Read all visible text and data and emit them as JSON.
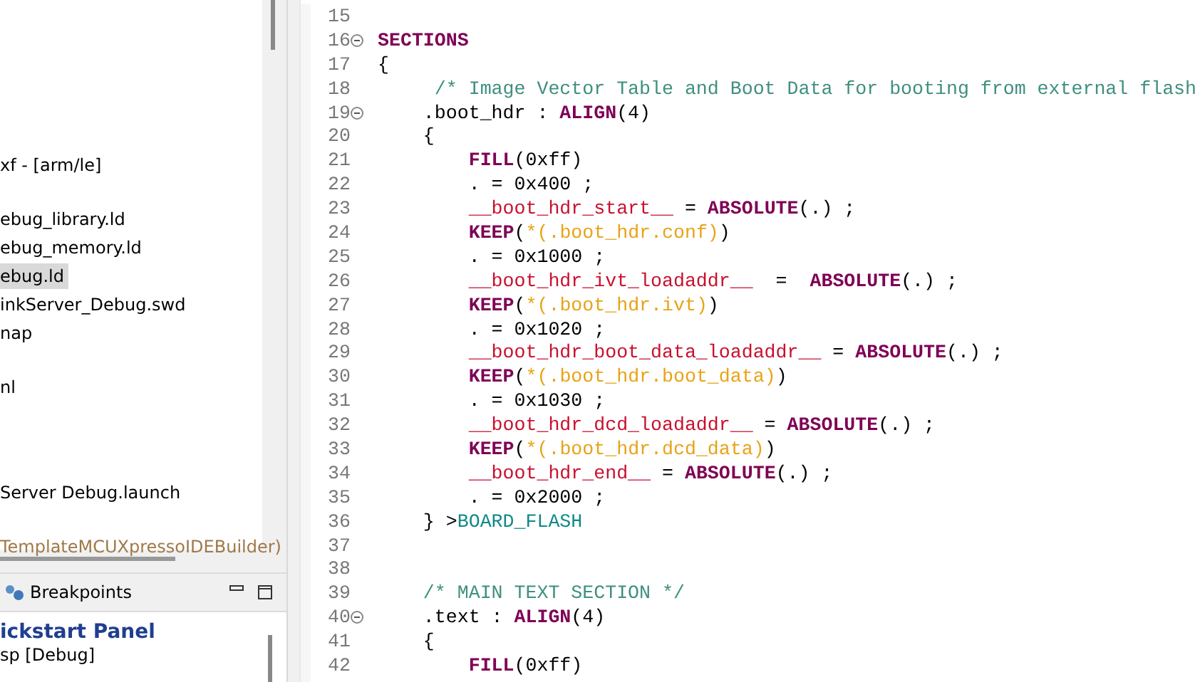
{
  "project_explorer": {
    "items": [
      {
        "label": "xf - [arm/le]",
        "selected": false,
        "kind": "plain"
      },
      {
        "label": "ebug_library.ld",
        "selected": false,
        "kind": "plain"
      },
      {
        "label": "ebug_memory.ld",
        "selected": false,
        "kind": "plain"
      },
      {
        "label": "ebug.ld",
        "selected": true,
        "kind": "plain"
      },
      {
        "label": "inkServer_Debug.swd",
        "selected": false,
        "kind": "plain"
      },
      {
        "label": "nap",
        "selected": false,
        "kind": "plain"
      },
      {
        "label": "nl",
        "selected": false,
        "kind": "plain"
      },
      {
        "label": "Server Debug.launch",
        "selected": false,
        "kind": "plain"
      },
      {
        "label": "TemplateMCUXpressoIDEBuilder)",
        "selected": false,
        "kind": "decoration"
      }
    ]
  },
  "bottom_view": {
    "tab": {
      "label": "Breakpoints"
    },
    "heading": "ickstart Panel",
    "subtitle": "sp [Debug]"
  },
  "editor": {
    "lines": [
      {
        "number": "15",
        "foldable": false
      },
      {
        "number": "16",
        "foldable": true,
        "tokens": [
          {
            "kind": "keyword",
            "text": "SECTIONS"
          }
        ]
      },
      {
        "number": "17",
        "foldable": false,
        "tokens": [
          {
            "kind": "plain",
            "text": "{"
          }
        ]
      },
      {
        "number": "18",
        "foldable": false,
        "tokens": [
          {
            "kind": "comment",
            "text": "     /* Image Vector Table and Boot Data for booting from external flash"
          }
        ]
      },
      {
        "number": "19",
        "foldable": true,
        "tokens": [
          {
            "kind": "plain",
            "text": "    .boot_hdr : "
          },
          {
            "kind": "keyword",
            "text": "ALIGN"
          },
          {
            "kind": "plain",
            "text": "(4)"
          }
        ]
      },
      {
        "number": "20",
        "foldable": false,
        "tokens": [
          {
            "kind": "plain",
            "text": "    {"
          }
        ]
      },
      {
        "number": "21",
        "foldable": false,
        "tokens": [
          {
            "kind": "keyword",
            "text": "        FILL"
          },
          {
            "kind": "plain",
            "text": "(0xff)"
          }
        ]
      },
      {
        "number": "22",
        "foldable": false,
        "tokens": [
          {
            "kind": "plain",
            "text": "        . = 0x400 ;"
          }
        ]
      },
      {
        "number": "23",
        "foldable": false,
        "tokens": [
          {
            "kind": "symbol",
            "text": "        __boot_hdr_start__"
          },
          {
            "kind": "plain",
            "text": " = "
          },
          {
            "kind": "keyword",
            "text": "ABSOLUTE"
          },
          {
            "kind": "plain",
            "text": "(.) ;"
          }
        ]
      },
      {
        "number": "24",
        "foldable": false,
        "tokens": [
          {
            "kind": "keyword",
            "text": "        KEEP"
          },
          {
            "kind": "plain",
            "text": "("
          },
          {
            "kind": "section",
            "text": "*(.boot_hdr.conf)"
          },
          {
            "kind": "plain",
            "text": ")"
          }
        ]
      },
      {
        "number": "25",
        "foldable": false,
        "tokens": [
          {
            "kind": "plain",
            "text": "        . = 0x1000 ;"
          }
        ]
      },
      {
        "number": "26",
        "foldable": false,
        "tokens": [
          {
            "kind": "symbol",
            "text": "        __boot_hdr_ivt_loadaddr__"
          },
          {
            "kind": "plain",
            "text": "  =  "
          },
          {
            "kind": "keyword",
            "text": "ABSOLUTE"
          },
          {
            "kind": "plain",
            "text": "(.) ;"
          }
        ]
      },
      {
        "number": "27",
        "foldable": false,
        "tokens": [
          {
            "kind": "keyword",
            "text": "        KEEP"
          },
          {
            "kind": "plain",
            "text": "("
          },
          {
            "kind": "section",
            "text": "*(.boot_hdr.ivt)"
          },
          {
            "kind": "plain",
            "text": ")"
          }
        ]
      },
      {
        "number": "28",
        "foldable": false,
        "tokens": [
          {
            "kind": "plain",
            "text": "        . = 0x1020 ;"
          }
        ]
      },
      {
        "number": "29",
        "foldable": false,
        "tokens": [
          {
            "kind": "symbol",
            "text": "        __boot_hdr_boot_data_loadaddr__"
          },
          {
            "kind": "plain",
            "text": " = "
          },
          {
            "kind": "keyword",
            "text": "ABSOLUTE"
          },
          {
            "kind": "plain",
            "text": "(.) ;"
          }
        ]
      },
      {
        "number": "30",
        "foldable": false,
        "tokens": [
          {
            "kind": "keyword",
            "text": "        KEEP"
          },
          {
            "kind": "plain",
            "text": "("
          },
          {
            "kind": "section",
            "text": "*(.boot_hdr.boot_data)"
          },
          {
            "kind": "plain",
            "text": ")"
          }
        ]
      },
      {
        "number": "31",
        "foldable": false,
        "tokens": [
          {
            "kind": "plain",
            "text": "        . = 0x1030 ;"
          }
        ]
      },
      {
        "number": "32",
        "foldable": false,
        "tokens": [
          {
            "kind": "symbol",
            "text": "        __boot_hdr_dcd_loadaddr__"
          },
          {
            "kind": "plain",
            "text": " = "
          },
          {
            "kind": "keyword",
            "text": "ABSOLUTE"
          },
          {
            "kind": "plain",
            "text": "(.) ;"
          }
        ]
      },
      {
        "number": "33",
        "foldable": false,
        "tokens": [
          {
            "kind": "keyword",
            "text": "        KEEP"
          },
          {
            "kind": "plain",
            "text": "("
          },
          {
            "kind": "section",
            "text": "*(.boot_hdr.dcd_data)"
          },
          {
            "kind": "plain",
            "text": ")"
          }
        ]
      },
      {
        "number": "34",
        "foldable": false,
        "tokens": [
          {
            "kind": "symbol",
            "text": "        __boot_hdr_end__"
          },
          {
            "kind": "plain",
            "text": " = "
          },
          {
            "kind": "keyword",
            "text": "ABSOLUTE"
          },
          {
            "kind": "plain",
            "text": "(.) ;"
          }
        ]
      },
      {
        "number": "35",
        "foldable": false,
        "tokens": [
          {
            "kind": "plain",
            "text": "        . = 0x2000 ;"
          }
        ]
      },
      {
        "number": "36",
        "foldable": false,
        "tokens": [
          {
            "kind": "plain",
            "text": "    } >"
          },
          {
            "kind": "region",
            "text": "BOARD_FLASH"
          }
        ]
      },
      {
        "number": "37",
        "foldable": false
      },
      {
        "number": "38",
        "foldable": false
      },
      {
        "number": "39",
        "foldable": false,
        "tokens": [
          {
            "kind": "comment",
            "text": "    /* MAIN TEXT SECTION */"
          }
        ]
      },
      {
        "number": "40",
        "foldable": true,
        "tokens": [
          {
            "kind": "plain",
            "text": "    .text : "
          },
          {
            "kind": "keyword",
            "text": "ALIGN"
          },
          {
            "kind": "plain",
            "text": "(4)"
          }
        ]
      },
      {
        "number": "41",
        "foldable": false,
        "tokens": [
          {
            "kind": "plain",
            "text": "    {"
          }
        ]
      },
      {
        "number": "42",
        "foldable": false,
        "tokens": [
          {
            "kind": "keyword",
            "text": "        FILL"
          },
          {
            "kind": "plain",
            "text": "(0xff)"
          }
        ]
      }
    ]
  }
}
